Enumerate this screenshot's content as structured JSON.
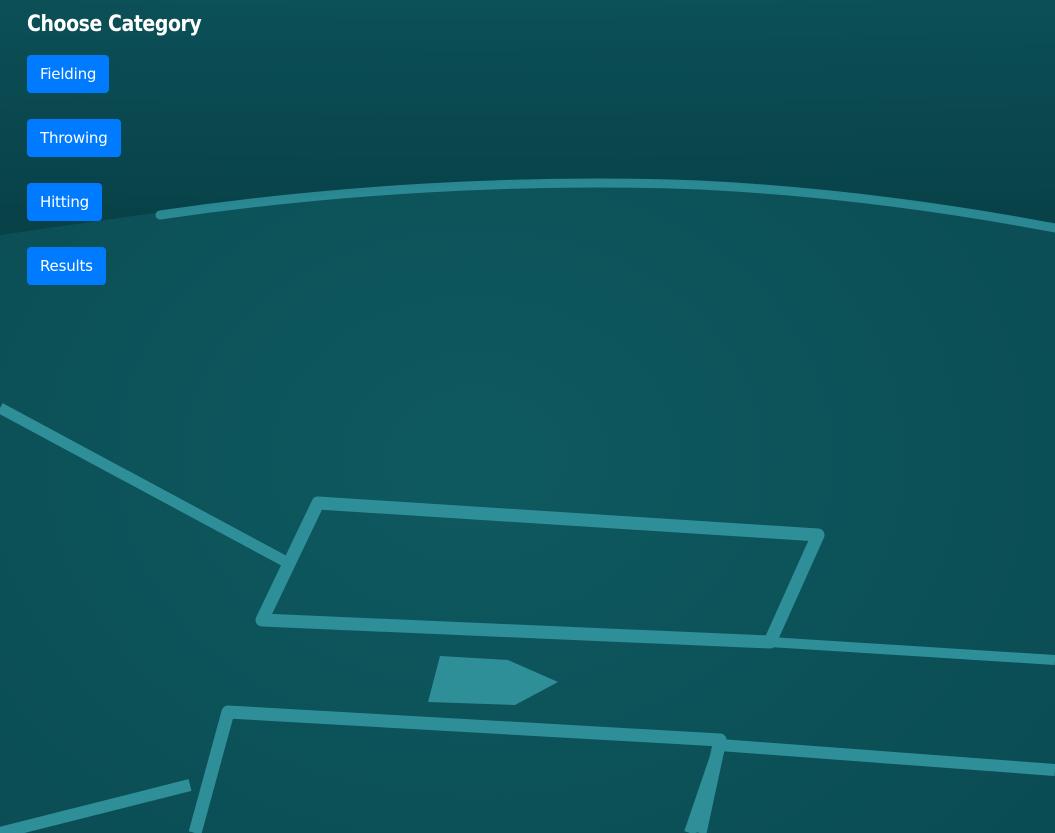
{
  "page": {
    "title": "Choose Category"
  },
  "categories": [
    {
      "label": "Fielding"
    },
    {
      "label": "Throwing"
    },
    {
      "label": "Hitting"
    },
    {
      "label": "Results"
    }
  ],
  "colors": {
    "background": "#0b4f56",
    "field_lines": "#2f8f99",
    "button": "#007bff",
    "title": "#ffffff"
  }
}
